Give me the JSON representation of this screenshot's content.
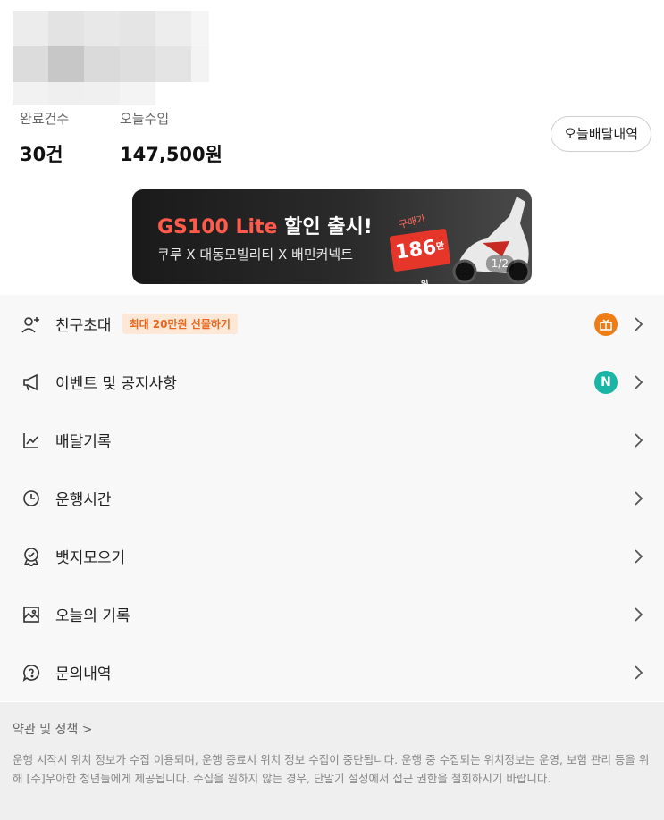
{
  "stats": {
    "completed_label": "완료건수",
    "completed_value": "30건",
    "income_label": "오늘수입",
    "income_value": "147,500원"
  },
  "today_history_button": "오늘배달내역",
  "banner": {
    "title_accent": "GS100 Lite",
    "title_rest": " 할인 출시!",
    "subtitle": "쿠루 X 대동모빌리티 X 배민커넥트",
    "price_note": "구매가",
    "price": "186",
    "price_unit": "만원",
    "page": "1/2"
  },
  "menu": {
    "items": [
      {
        "label": "친구초대",
        "icon": "add-user-icon",
        "badge": "최대 20만원 선물하기",
        "indicator": "gift-icon"
      },
      {
        "label": "이벤트 및 공지사항",
        "icon": "megaphone-icon",
        "indicator": "N"
      },
      {
        "label": "배달기록",
        "icon": "chart-line-icon"
      },
      {
        "label": "운행시간",
        "icon": "clock-icon"
      },
      {
        "label": "뱃지모으기",
        "icon": "badge-icon"
      },
      {
        "label": "오늘의 기록",
        "icon": "image-icon"
      },
      {
        "label": "문의내역",
        "icon": "question-chat-icon"
      }
    ]
  },
  "footer": {
    "terms_link": "약관 및 정책 >",
    "notice": "운행 시작시 위치 정보가 수집 이용되며, 운행 종료시 위치 정보 수집이 중단됩니다. 운행 중 수집되는 위치정보는 운영, 보험 관리 등을 위해 [주]우아한 청년들에게 제공됩니다. 수집을 원하지 않는 경우, 단말기 설정에서 접근 권한을 철회하시기 바랍니다."
  },
  "colors": {
    "accent_orange": "#f07c13",
    "notice_teal": "#1bb5a6",
    "banner_red": "#e6362a"
  }
}
